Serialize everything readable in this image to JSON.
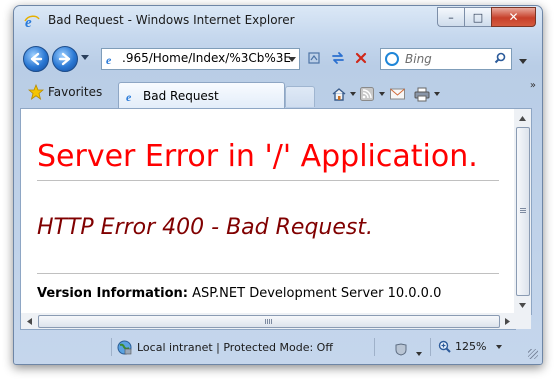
{
  "window": {
    "title": "Bad Request - Windows Internet Explorer",
    "caption_buttons": {
      "minimize": "–",
      "maximize": "□",
      "close": "✕"
    }
  },
  "address_bar": {
    "url": ".965/Home/Index/%3Cb%3E"
  },
  "search": {
    "placeholder": "Bing"
  },
  "favorites": {
    "label": "Favorites"
  },
  "tab": {
    "title": "Bad Request"
  },
  "page": {
    "heading": "Server Error in '/' Application.",
    "error_title": "HTTP Error 400 - Bad Request.",
    "version_label": "Version Information:",
    "version_value": "ASP.NET Development Server 10.0.0.0"
  },
  "statusbar": {
    "zone": "Local intranet | Protected Mode: Off",
    "zoom": "125%"
  },
  "colors": {
    "heading": "#ff0000",
    "error_title": "#800000",
    "chrome": "#c6d8ee"
  },
  "icons": [
    "ie-icon",
    "back-icon",
    "forward-icon",
    "page-icon",
    "compatibility-icon",
    "refresh-icon",
    "stop-icon",
    "bing-icon",
    "search-icon",
    "star-icon",
    "home-icon",
    "rss-icon",
    "mail-icon",
    "print-icon",
    "globe-icon",
    "zoom-icon"
  ]
}
